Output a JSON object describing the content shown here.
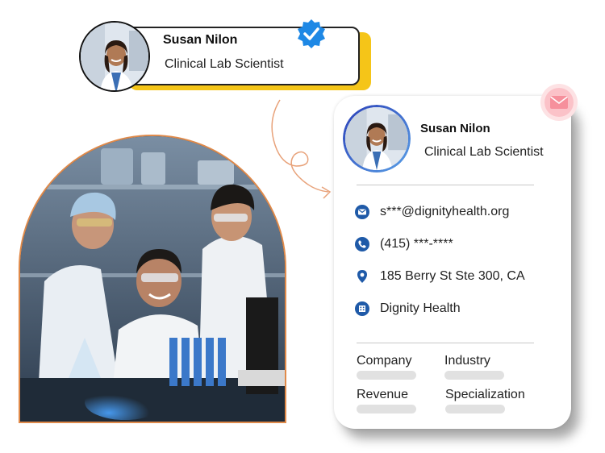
{
  "top_badge": {
    "name": "Susan Nilon",
    "role": "Clinical Lab Scientist",
    "verified_icon": "verified-badge-icon"
  },
  "profile": {
    "name": "Susan Nilon",
    "role": "Clinical Lab Scientist",
    "contact": {
      "email": "s***@dignityhealth.org",
      "phone": "(415) ***-****",
      "address": "185 Berry St Ste 300, CA",
      "organization": "Dignity Health"
    },
    "fields": {
      "company": "Company",
      "industry": "Industry",
      "revenue": "Revenue",
      "specialization": "Specialization"
    }
  },
  "colors": {
    "accent_blue": "#1f5aa8",
    "badge_yellow": "#f5c518",
    "verified_blue": "#1e88e5",
    "arch_border": "#e08a4a",
    "mail_pink": "#f8a3ad"
  }
}
